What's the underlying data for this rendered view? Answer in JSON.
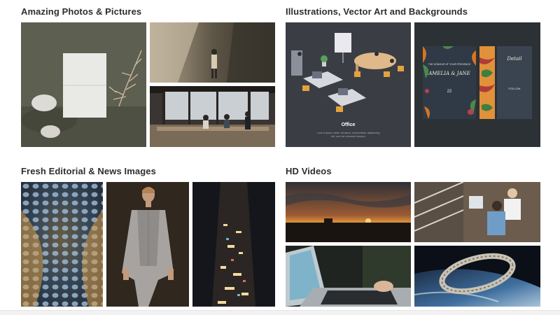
{
  "sections": [
    {
      "title": "Amazing Photos & Pictures"
    },
    {
      "title": "Illustrations, Vector Art and Backgrounds"
    },
    {
      "title": "Fresh Editorial & News Images"
    },
    {
      "title": "HD Videos"
    }
  ],
  "illustrations": {
    "office_caption": "Office",
    "office_lorem": "Lorem ipsum dolor sit amet, consectetur adipiscing elit, sed do eiusmod tempor",
    "invite_line1": "THE HONOUR OF YOUR PRESENCE",
    "invite_names": "AMELIA & JANE",
    "invite_date": "22",
    "details_title": "Detail",
    "details_follow": "FOLLOW"
  },
  "colors": {
    "title_text": "#2e2e2e",
    "office_bg": "#3b3d45",
    "invite_bg": "#2c3136"
  }
}
